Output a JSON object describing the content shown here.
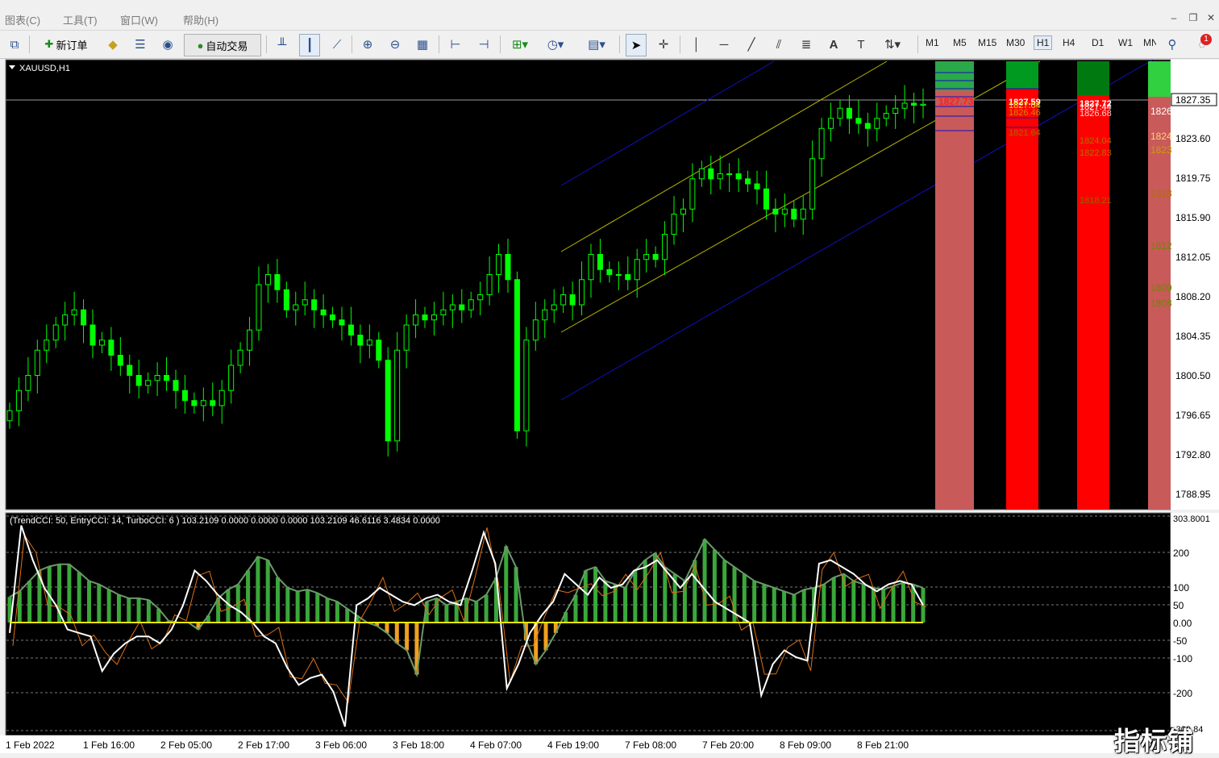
{
  "menu": {
    "items": [
      "图表(C)",
      "工具(T)",
      "窗口(W)",
      "帮助(H)"
    ]
  },
  "toolbar": {
    "new_order": "新订单",
    "auto_trade": "自动交易",
    "timeframes": [
      "M1",
      "M5",
      "M15",
      "M30",
      "H1",
      "H4",
      "D1",
      "W1",
      "MN"
    ],
    "active_timeframe": "H1",
    "notification_count": "1"
  },
  "main_chart": {
    "symbol_label": "XAUUSD,H1",
    "current_price": "1827.35",
    "price_axis": [
      "1823.60",
      "1819.75",
      "1815.90",
      "1812.05",
      "1808.20",
      "1804.35",
      "1800.50",
      "1796.65",
      "1792.80",
      "1788.95"
    ],
    "bull_color": "#00ff00",
    "bear_color": "#00ff00"
  },
  "zones": {
    "col1_labels": [
      "1827.73"
    ],
    "col2_labels": [
      "1827.59",
      "1827.04",
      "1826.46",
      "1821.64"
    ],
    "col3_labels": [
      "1827.72",
      "1827.44",
      "1826.68",
      "1824.04",
      "1822.83",
      "1818.21"
    ],
    "col4_labels": [
      "1826",
      "1824",
      "1823",
      "1818",
      "1812",
      "1809",
      "1808"
    ]
  },
  "indicator": {
    "title": "(TrendCCI: 50, EntryCCI: 14, TurboCCI: 6 )  103.2109 0.0000 0.0000 0.0000 103.2109 46.6116 3.4834 0.0000",
    "axis": [
      "200",
      "100",
      "50",
      "0.00",
      "-50",
      "-100",
      "-200"
    ],
    "axis_top": "303.8001",
    "axis_bottom": "-300.84"
  },
  "time_axis": [
    "1 Feb 2022",
    "1 Feb 16:00",
    "2 Feb 05:00",
    "2 Feb 17:00",
    "3 Feb 06:00",
    "3 Feb 18:00",
    "4 Feb 07:00",
    "4 Feb 19:00",
    "7 Feb 08:00",
    "7 Feb 20:00",
    "8 Feb 09:00",
    "8 Feb 21:00"
  ],
  "watermark": "指标铺",
  "chart_data": {
    "type": "candlestick",
    "symbol": "XAUUSD",
    "timeframe": "H1",
    "ylim": [
      1787.5,
      1831.5
    ],
    "closes": [
      1797,
      1799,
      1800.5,
      1803,
      1804,
      1805.5,
      1806.5,
      1807,
      1805.5,
      1803.5,
      1804,
      1802.5,
      1801.5,
      1800.5,
      1799.5,
      1800,
      1800.5,
      1800,
      1799,
      1798,
      1797.5,
      1798,
      1797.5,
      1799,
      1801.5,
      1803,
      1805,
      1809.5,
      1810.5,
      1809,
      1807,
      1807.5,
      1808,
      1807,
      1806.5,
      1806,
      1805.5,
      1804.5,
      1803.5,
      1804,
      1802,
      1794,
      1803,
      1805.5,
      1806.5,
      1806,
      1806.5,
      1807,
      1807.5,
      1807,
      1808,
      1808.5,
      1810.5,
      1812.5,
      1810,
      1795,
      1804,
      1806,
      1807,
      1807.5,
      1808.5,
      1807.5,
      1810,
      1812.5,
      1811,
      1810.5,
      1810.5,
      1810,
      1812,
      1812.5,
      1812,
      1814.5,
      1816.5,
      1817,
      1820,
      1821,
      1820,
      1820.5,
      1820.5,
      1820,
      1819.5,
      1819,
      1817,
      1816.5,
      1817,
      1816,
      1817,
      1822,
      1825,
      1826,
      1827,
      1826,
      1825.5,
      1825,
      1826,
      1826.5,
      1827,
      1827.5,
      1827.3,
      1827.4
    ],
    "channel_upper_color": "#0000cc",
    "channel_inner_color": "#c8c800",
    "indicator": {
      "type": "histogram+lines",
      "ylim": [
        -300.84,
        303.8
      ],
      "histogram": [
        74,
        90,
        120,
        150,
        162,
        168,
        168,
        145,
        120,
        110,
        95,
        80,
        70,
        70,
        65,
        40,
        5,
        0,
        0,
        -20,
        20,
        70,
        95,
        110,
        150,
        190,
        180,
        130,
        100,
        90,
        95,
        85,
        70,
        60,
        40,
        20,
        0,
        -10,
        -30,
        -60,
        -80,
        -150,
        60,
        70,
        50,
        60,
        70,
        60,
        80,
        130,
        220,
        160,
        -50,
        -120,
        -80,
        -30,
        30,
        80,
        150,
        160,
        120,
        110,
        100,
        150,
        180,
        200,
        160,
        140,
        120,
        180,
        240,
        210,
        180,
        160,
        140,
        120,
        110,
        100,
        90,
        80,
        95,
        100,
        110,
        130,
        140,
        120,
        110,
        100,
        95,
        105,
        115,
        110,
        100
      ],
      "white_line": [
        -30,
        280,
        180,
        100,
        50,
        -20,
        -30,
        -40,
        -140,
        -90,
        -60,
        -40,
        -40,
        -60,
        -20,
        50,
        150,
        120,
        80,
        50,
        30,
        0,
        -40,
        -60,
        -130,
        -180,
        -160,
        -150,
        -200,
        -300,
        50,
        70,
        100,
        80,
        60,
        50,
        70,
        80,
        60,
        50,
        150,
        260,
        170,
        -190,
        -120,
        -30,
        20,
        60,
        140,
        110,
        80,
        130,
        100,
        110,
        150,
        160,
        180,
        140,
        100,
        140,
        100,
        60,
        40,
        20,
        0,
        -210,
        -120,
        -80,
        -100,
        -110,
        170,
        180,
        160,
        140,
        110,
        90,
        110,
        120,
        110,
        50
      ]
    }
  }
}
